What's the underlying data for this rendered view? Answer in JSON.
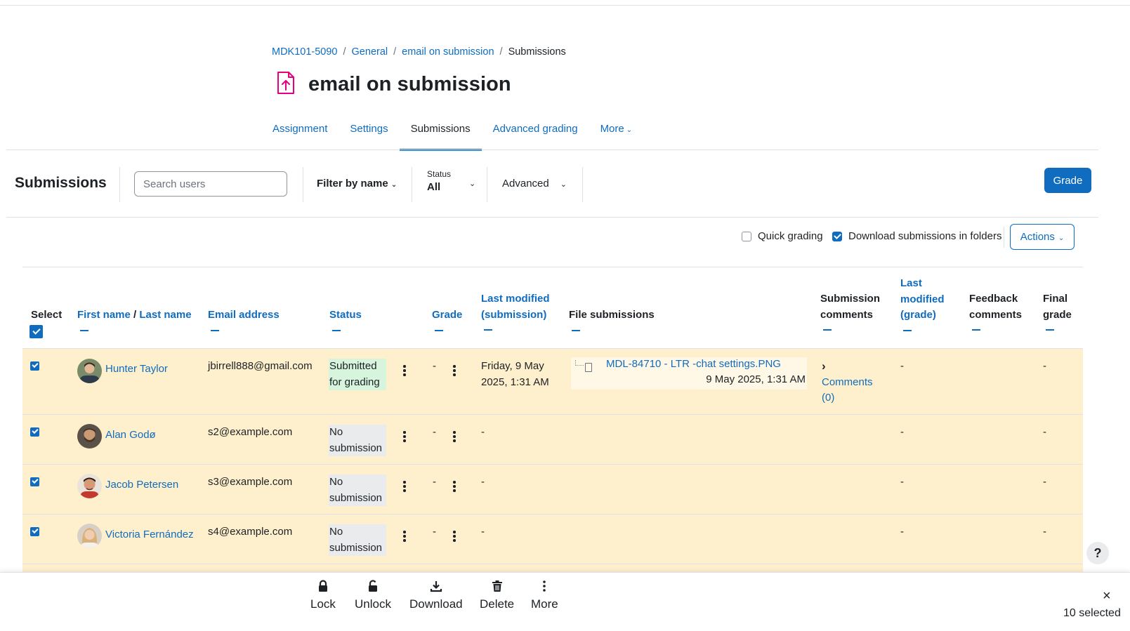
{
  "breadcrumb": [
    "MDK101-5090",
    "General",
    "email on submission",
    "Submissions"
  ],
  "page_title": "email on submission",
  "tabs": [
    {
      "label": "Assignment"
    },
    {
      "label": "Settings"
    },
    {
      "label": "Submissions"
    },
    {
      "label": "Advanced grading"
    },
    {
      "label": "More"
    }
  ],
  "active_tab": "Submissions",
  "toolbar": {
    "title": "Submissions",
    "search_placeholder": "Search users",
    "filter_by_name": "Filter by name",
    "status_label": "Status",
    "status_value": "All",
    "advanced": "Advanced",
    "grade_button": "Grade"
  },
  "options": {
    "quick_grading": "Quick grading",
    "quick_grading_checked": false,
    "download_in_folders": "Download submissions in folders",
    "download_in_folders_checked": true,
    "actions": "Actions"
  },
  "table": {
    "headers": {
      "select": "Select",
      "first_name": "First name",
      "slash": " / ",
      "last_name": "Last name",
      "email": "Email address",
      "status": "Status",
      "grade": "Grade",
      "last_modified_sub_1": "Last modified",
      "last_modified_sub_2": "(submission)",
      "file_submissions": "File submissions",
      "submission_comments_1": "Submission",
      "submission_comments_2": "comments",
      "last_modified_grade_1": "Last",
      "last_modified_grade_2": "modified",
      "last_modified_grade_3": "(grade)",
      "feedback_comments_1": "Feedback",
      "feedback_comments_2": "comments",
      "final_grade_1": "Final",
      "final_grade_2": "grade"
    },
    "rows": [
      {
        "name": "Hunter Taylor",
        "email": "jbirrell888@gmail.com",
        "status_1": "Submitted",
        "status_2": "for grading",
        "grade": "-",
        "last_modified_1": "Friday, 9 May",
        "last_modified_2": "2025, 1:31 AM",
        "file_name": "MDL-84710 - LTR -chat settings.PNG",
        "file_date": "9 May 2025, 1:31 AM",
        "comments_1": "Comments",
        "comments_2": "(0)",
        "last_modified_grade": "-",
        "final_grade": "-"
      },
      {
        "name": "Alan Godø",
        "email": "s2@example.com",
        "status_1": "No",
        "status_2": "submission",
        "grade": "-",
        "last_modified_1": "-",
        "last_modified_grade": "-",
        "final_grade": "-"
      },
      {
        "name": "Jacob Petersen",
        "email": "s3@example.com",
        "status_1": "No",
        "status_2": "submission",
        "grade": "-",
        "last_modified_1": "-",
        "last_modified_grade": "-",
        "final_grade": "-"
      },
      {
        "name": "Victoria Fernández",
        "email": "s4@example.com",
        "status_1": "No",
        "status_2": "submission",
        "grade": "-",
        "last_modified_1": "-",
        "last_modified_grade": "-",
        "final_grade": "-"
      }
    ]
  },
  "bulk_bar": {
    "lock": "Lock",
    "unlock": "Unlock",
    "download": "Download",
    "delete": "Delete",
    "more": "More",
    "close_icon": "×",
    "selected_count": "10 selected"
  },
  "help_label": "?",
  "colors": {
    "accent": "#0f6cbf",
    "row_highlight": "#fff0cd",
    "submitted_badge": "#d7f4dd",
    "no_submission_badge": "#e9ebed",
    "module_icon": "#e6007e"
  }
}
